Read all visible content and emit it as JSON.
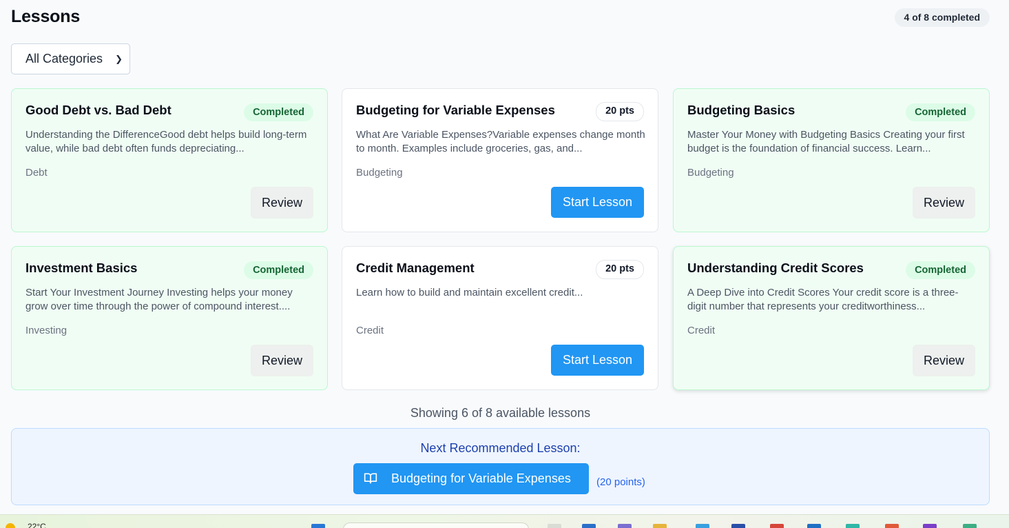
{
  "header": {
    "title": "Lessons",
    "progress": "4 of 8 completed"
  },
  "filter": {
    "selected": "All Categories"
  },
  "lessons": [
    {
      "title": "Good Debt vs. Bad Debt",
      "status": "Completed",
      "description": "Understanding the DifferenceGood debt helps build long-term value, while bad debt often funds depreciating...",
      "category": "Debt",
      "action": "Review"
    },
    {
      "title": "Budgeting for Variable Expenses",
      "status": "20 pts",
      "description": "What Are Variable Expenses?Variable expenses change month to month. Examples include groceries, gas, and...",
      "category": "Budgeting",
      "action": "Start Lesson"
    },
    {
      "title": "Budgeting Basics",
      "status": "Completed",
      "description": "Master Your Money with Budgeting Basics Creating your first budget is the foundation of financial success. Learn...",
      "category": "Budgeting",
      "action": "Review"
    },
    {
      "title": "Investment Basics",
      "status": "Completed",
      "description": "Start Your Investment Journey Investing helps your money grow over time through the power of compound interest....",
      "category": "Investing",
      "action": "Review"
    },
    {
      "title": "Credit Management",
      "status": "20 pts",
      "description": "Learn how to build and maintain excellent credit...",
      "category": "Credit",
      "action": "Start Lesson"
    },
    {
      "title": "Understanding Credit Scores",
      "status": "Completed",
      "description": "A Deep Dive into Credit Scores Your credit score is a three-digit number that represents your creditworthiness...",
      "category": "Credit",
      "action": "Review"
    }
  ],
  "showing_text": "Showing 6 of 8 available lessons",
  "next": {
    "heading": "Next Recommended Lesson:",
    "lesson": "Budgeting for Variable Expenses",
    "points": "(20 points)",
    "icon": "book-open-icon"
  },
  "taskbar": {
    "temperature": "22°C"
  },
  "colors": {
    "accent": "#2196f3",
    "completed_bg": "#f0fdf4",
    "completed_badge": "#166534"
  }
}
